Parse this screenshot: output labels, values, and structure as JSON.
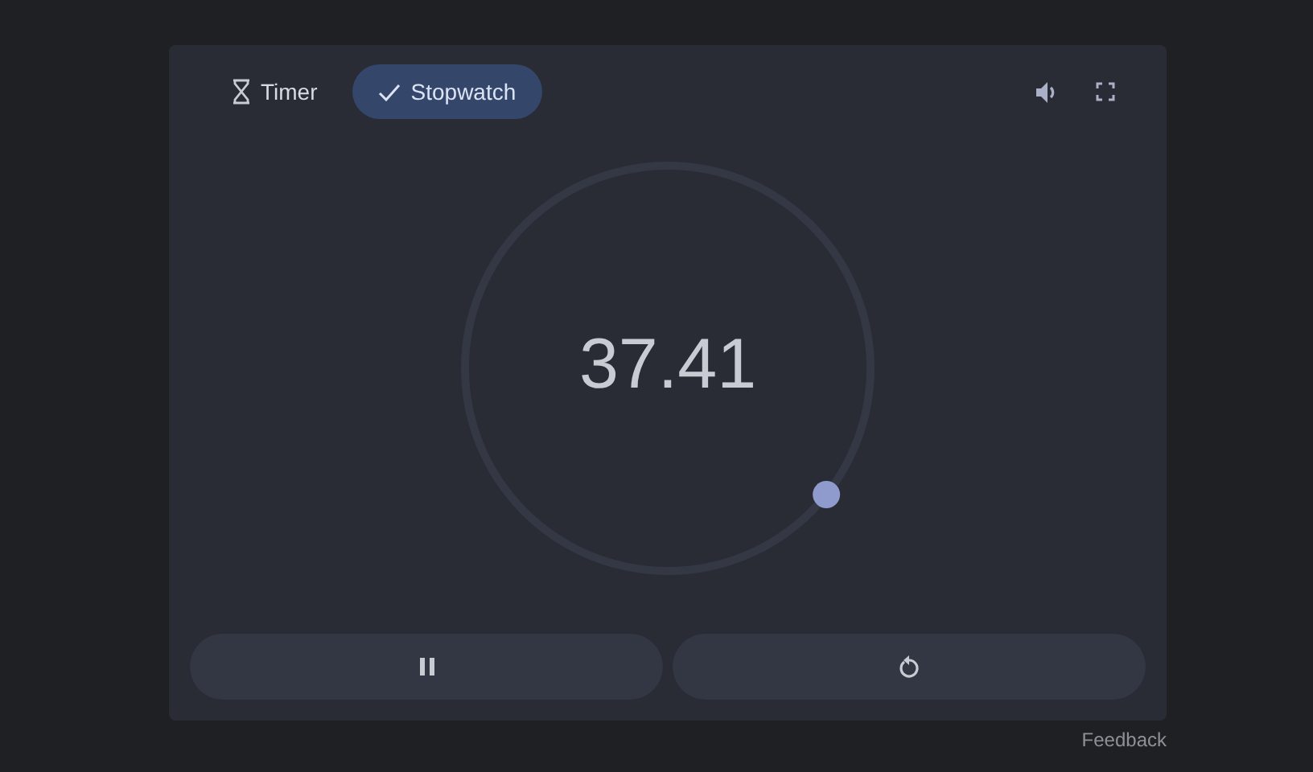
{
  "tabs": [
    {
      "label": "Timer",
      "kind": "timer",
      "selected": false
    },
    {
      "label": "Stopwatch",
      "kind": "stopwatch",
      "selected": true
    }
  ],
  "stopwatch": {
    "reading": "37.41"
  },
  "controls": [
    {
      "kind": "pause"
    },
    {
      "kind": "reset"
    }
  ],
  "feedback": "Feedback"
}
